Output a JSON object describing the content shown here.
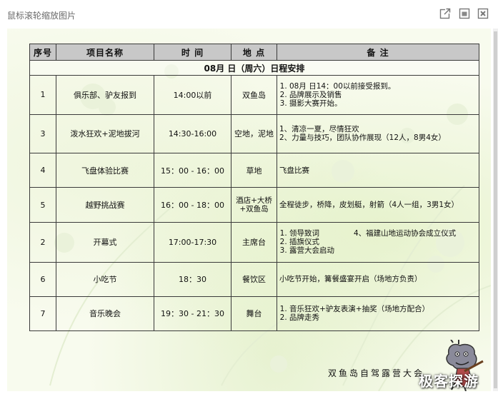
{
  "window": {
    "title": "鼠标滚轮缩放图片",
    "buttons": {
      "popout": "popout-icon",
      "restore": "restore-icon",
      "close": "close-icon"
    }
  },
  "table": {
    "headers": [
      "序号",
      "项目名称",
      "时 间",
      "地 点",
      "备 注"
    ],
    "date_heading": "08月 日（周六）日程安排",
    "rows": [
      {
        "no": "1",
        "name": "俱乐部、驴友报到",
        "time": "14:00以前",
        "place": "双鱼岛",
        "notes": [
          "08月 日14：00以前接受报到。",
          "品牌展示及销售",
          "摄影大赛开始。"
        ]
      },
      {
        "no": "3",
        "name": "泼水狂欢+泥地拔河",
        "time": "14:30-16:00",
        "place": "空地，泥地",
        "notes": [
          "1、清凉一夏，尽情狂欢",
          "2、力量与技巧，团队协作展现（12人，8男4女）"
        ]
      },
      {
        "no": "4",
        "name": "飞盘体验比赛",
        "time": "15：00 - 16：00",
        "place": "草地",
        "notes": [
          "飞盘比赛"
        ]
      },
      {
        "no": "5",
        "name": "越野挑战赛",
        "time": "16：00 - 18：00",
        "place": "酒店+大桥+双鱼岛",
        "notes": [
          "全程徒步，桥降，皮划艇，射箭（4人一组，3男1女）"
        ]
      },
      {
        "no": "2",
        "name": "开幕式",
        "time": "17:00-17:30",
        "place": "主席台",
        "notes": [
          "领导致词",
          "4、福建山地运动协会成立仪式",
          "插旗仪式",
          "露营大会启动"
        ]
      },
      {
        "no": "6",
        "name": "小吃节",
        "time": "18：30",
        "place": "餐饮区",
        "notes": [
          "小吃节开始，篝餐盛宴开启（场地方负责）"
        ]
      },
      {
        "no": "7",
        "name": "音乐晚会",
        "time": "19：30 - 21：30",
        "place": "舞台",
        "notes": [
          "音乐狂欢+驴友表演+抽奖（场地方配合）",
          "品牌走秀"
        ]
      }
    ]
  },
  "footer": "双鱼岛自驾露营大会",
  "watermark": "极客探游",
  "colors": {
    "header_bg": "#c8c8c8",
    "grid": "#3a3a3a",
    "backdrop": "#f8fbee",
    "title_text": "#6a6a6a"
  }
}
